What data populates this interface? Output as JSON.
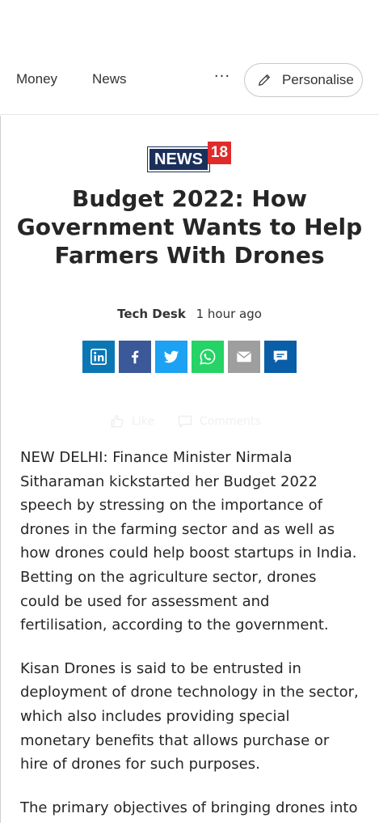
{
  "nav": {
    "links": [
      "Money",
      "News"
    ],
    "more_label": "···",
    "personalise_label": "Personalise"
  },
  "logo": {
    "text": "NEWS",
    "number": "18"
  },
  "article": {
    "headline": "Budget 2022: How Government Wants to Help Farmers With Drones",
    "author": "Tech Desk",
    "time": "1 hour ago",
    "share": [
      "linkedin-icon",
      "facebook-icon",
      "twitter-icon",
      "whatsapp-icon",
      "email-icon",
      "comment-icon"
    ],
    "reactions": {
      "like_label": "Like",
      "comments_label": "Comments"
    },
    "paragraphs": [
      "NEW DELHI: Finance Minister Nirmala Sitharaman kickstarted her Budget 2022 speech by stressing on the importance of drones in the farming sector and as well as how drones could help boost startups in India. Betting on the agriculture sector, drones could be used for assessment and fertilisation, according to the government.",
      "Kisan Drones is said to be entrusted in deployment of drone technology in the sector, which also includes providing special monetary benefits that allows purchase or hire of drones for such purposes.",
      "The primary objectives of bringing drones into"
    ]
  },
  "colors": {
    "linkedin": "#0a77b5",
    "facebook": "#3b5998",
    "twitter": "#1da1f2",
    "whatsapp": "#25d366",
    "email": "#9e9e9e",
    "comment": "#0a5ea8",
    "logo_navy": "#1a2f5a",
    "logo_red": "#e02b2b"
  }
}
